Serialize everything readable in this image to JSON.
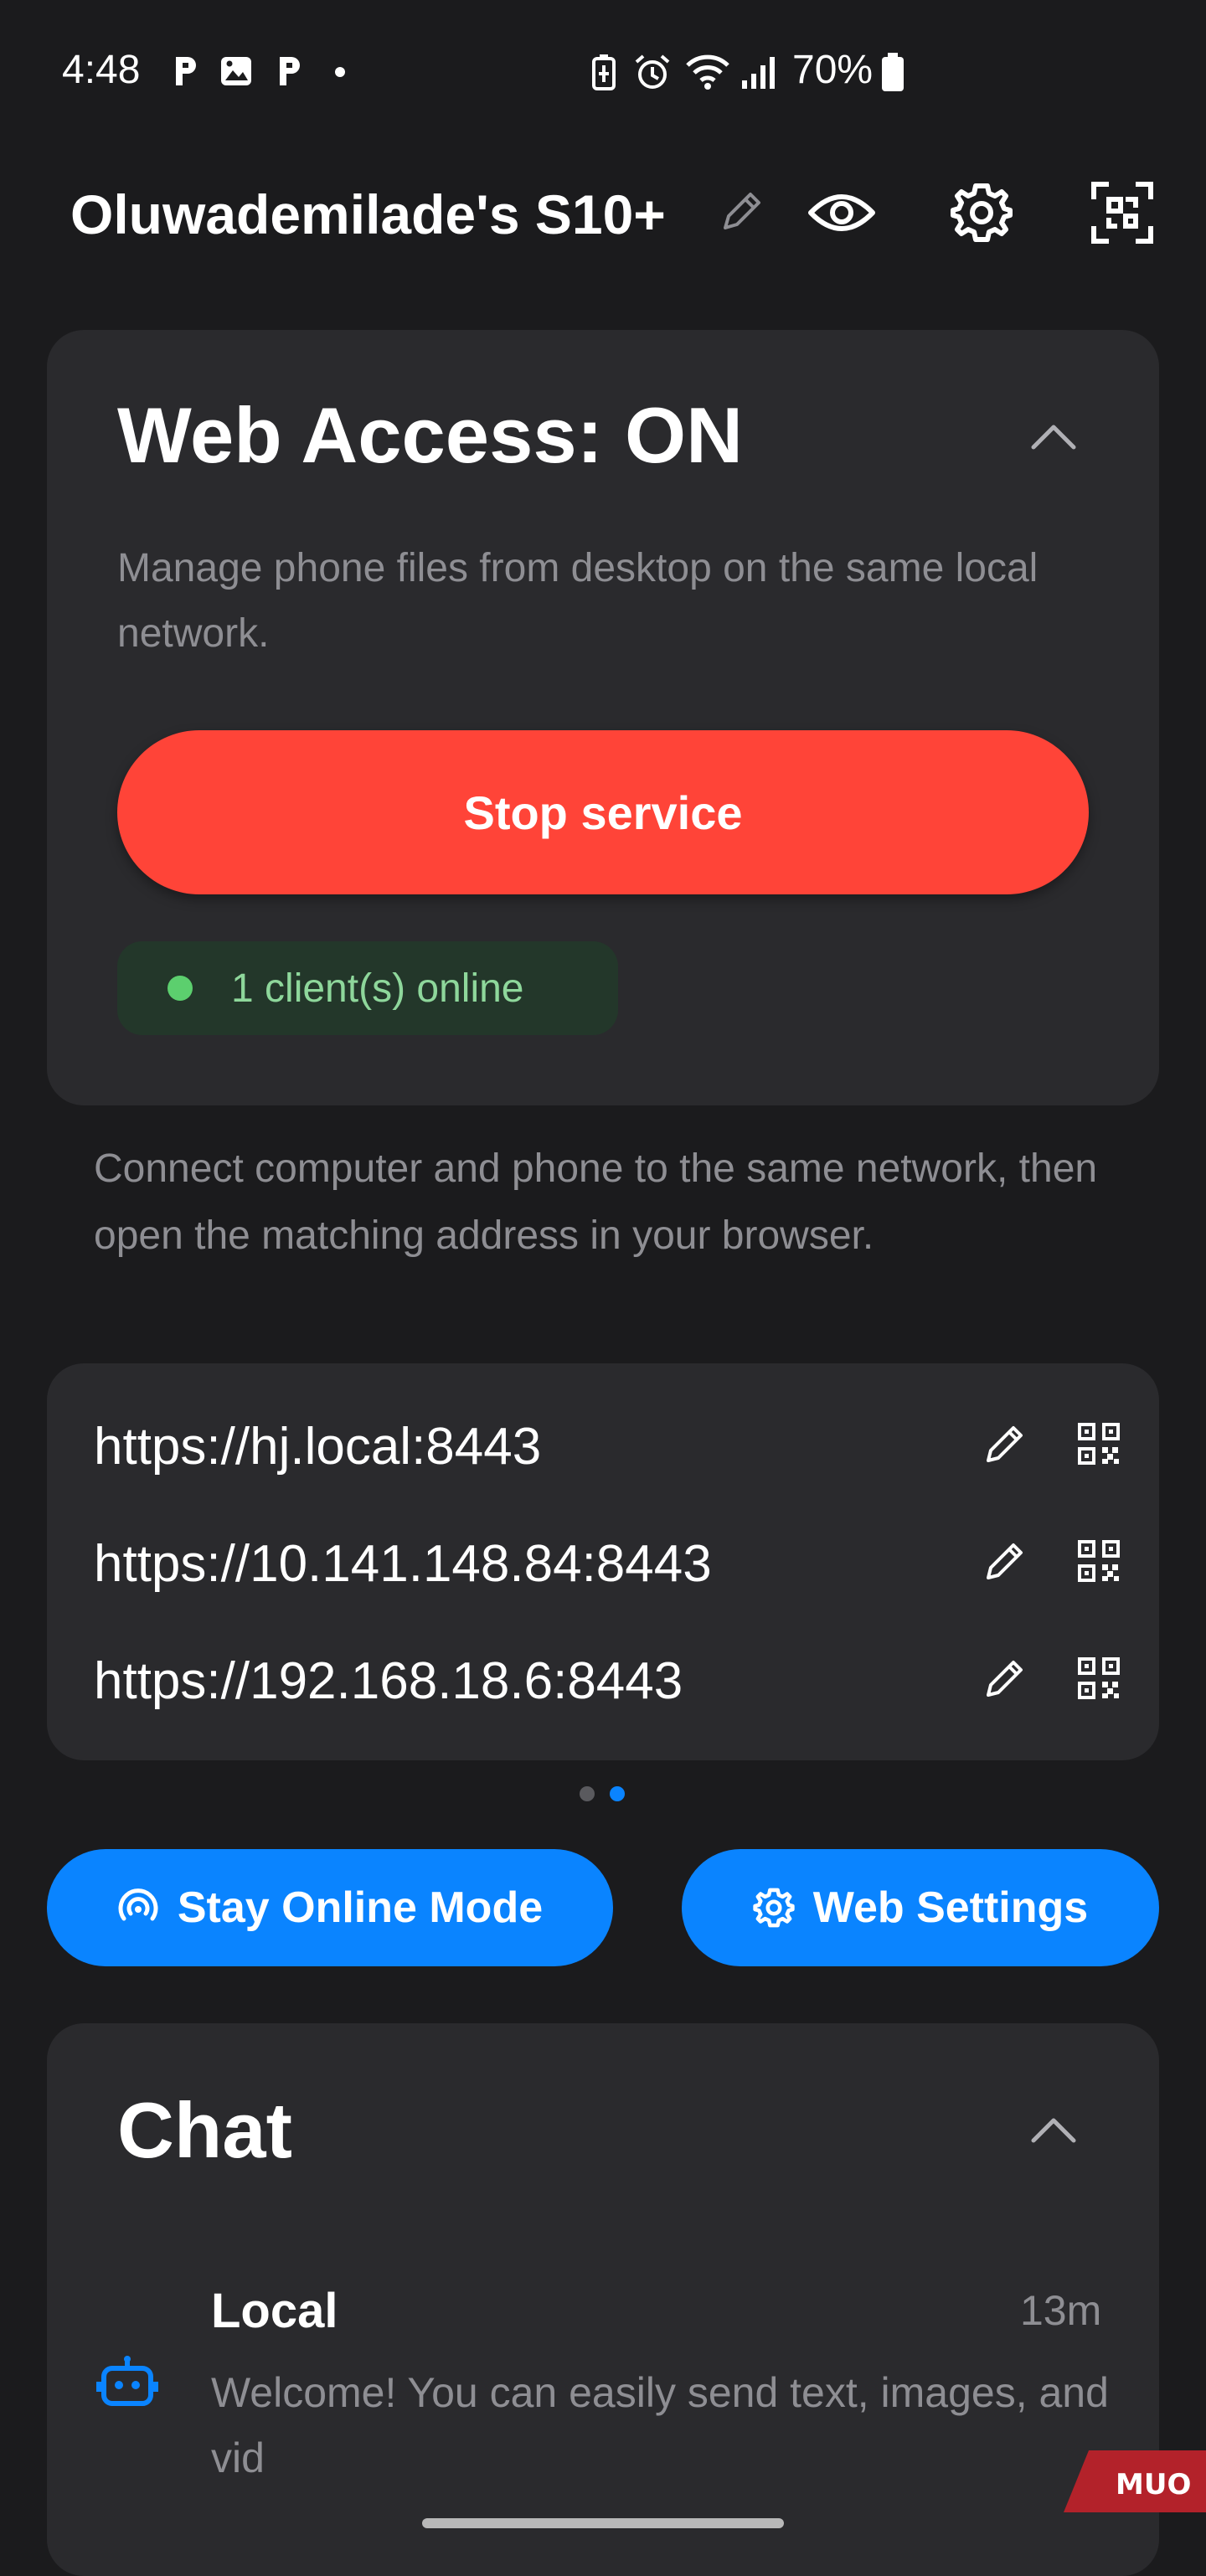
{
  "status_bar": {
    "time": "4:48",
    "battery": "70%",
    "left_icons": [
      "p-notification-icon",
      "gallery-icon",
      "p-notification-icon",
      "dot-icon"
    ],
    "right_icons": [
      "battery-saver-icon",
      "alarm-icon",
      "wifi-icon",
      "signal-icon",
      "battery-icon"
    ]
  },
  "header": {
    "device_name": "Oluwademilade's S10+",
    "icons": [
      "edit-pencil-icon",
      "eye-icon",
      "settings-gear-icon",
      "scan-icon"
    ]
  },
  "web_access": {
    "title": "Web Access: ON",
    "description": "Manage phone files from desktop on the same local network.",
    "stop_button": "Stop service",
    "status": "1 client(s) online"
  },
  "connect_instructions": "Connect computer and phone to the same network, then open the matching address in your browser.",
  "addresses": [
    {
      "url": "https://hj.local:8443"
    },
    {
      "url": "https://10.141.148.84:8443"
    },
    {
      "url": "https://192.168.18.6:8443"
    }
  ],
  "pager": {
    "total": 2,
    "active": 2
  },
  "buttons": {
    "stay_online": "Stay Online Mode",
    "web_settings": "Web Settings"
  },
  "chat": {
    "title": "Chat",
    "items": [
      {
        "name": "Local",
        "time": "13m",
        "message": "Welcome! You can easily send text, images, and vid"
      }
    ]
  },
  "watermark": "MUO",
  "colors": {
    "background": "#1b1b1d",
    "card": "#2a2a2d",
    "stop_red": "#ff4438",
    "accent_blue": "#0a84ff",
    "online_green": "#5ccf6e",
    "muted_text": "#8e8e93"
  }
}
